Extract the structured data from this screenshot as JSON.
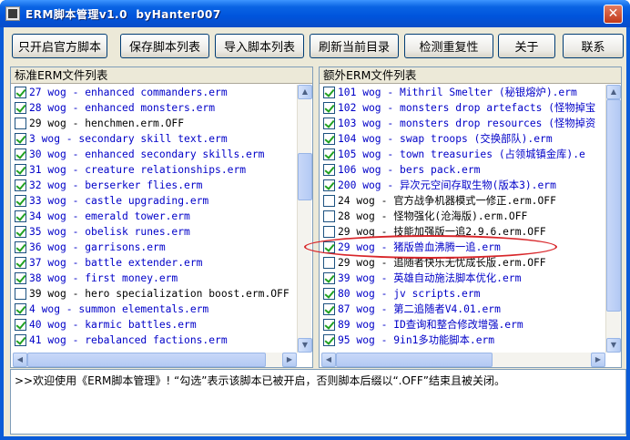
{
  "window": {
    "title": "ERM脚本管理v1.0  byHanter007",
    "close_label": "✕"
  },
  "toolbar": [
    {
      "label": "只开启官方脚本"
    },
    {
      "label": "保存脚本列表"
    },
    {
      "label": "导入脚本列表"
    },
    {
      "label": "刷新当前目录"
    },
    {
      "label": "检测重复性"
    },
    {
      "label": "关于"
    },
    {
      "label": "联系"
    }
  ],
  "left_panel": {
    "header": "标准ERM文件列表",
    "items": [
      {
        "text": "27 wog - enhanced commanders.erm",
        "checked": true
      },
      {
        "text": "28 wog - enhanced monsters.erm",
        "checked": true
      },
      {
        "text": "29 wog - henchmen.erm.OFF",
        "checked": false
      },
      {
        "text": "3 wog - secondary skill text.erm",
        "checked": true
      },
      {
        "text": "30 wog - enhanced secondary skills.erm",
        "checked": true
      },
      {
        "text": "31 wog - creature relationships.erm",
        "checked": true
      },
      {
        "text": "32 wog - berserker flies.erm",
        "checked": true
      },
      {
        "text": "33 wog - castle upgrading.erm",
        "checked": true
      },
      {
        "text": "34 wog - emerald tower.erm",
        "checked": true
      },
      {
        "text": "35 wog - obelisk runes.erm",
        "checked": true
      },
      {
        "text": "36 wog - garrisons.erm",
        "checked": true
      },
      {
        "text": "37 wog - battle extender.erm",
        "checked": true
      },
      {
        "text": "38 wog - first money.erm",
        "checked": true
      },
      {
        "text": "39 wog - hero specialization boost.erm.OFF",
        "checked": false
      },
      {
        "text": "4 wog - summon elementals.erm",
        "checked": true
      },
      {
        "text": "40 wog - karmic battles.erm",
        "checked": true
      },
      {
        "text": "41 wog - rebalanced factions.erm",
        "checked": true
      }
    ]
  },
  "right_panel": {
    "header": "额外ERM文件列表",
    "items": [
      {
        "text": "101 wog - Mithril Smelter (秘银熔炉).erm",
        "checked": true
      },
      {
        "text": "102 wog - monsters drop artefacts (怪物掉宝",
        "checked": true
      },
      {
        "text": "103 wog - monsters drop resources (怪物掉资",
        "checked": true
      },
      {
        "text": "104 wog - swap troops (交换部队).erm",
        "checked": true
      },
      {
        "text": "105 wog - town treasuries (占领城镇金库).e",
        "checked": true
      },
      {
        "text": "106 wog - bers pack.erm",
        "checked": true
      },
      {
        "text": "200 wog - 异次元空间存取生物(版本3).erm",
        "checked": true
      },
      {
        "text": "24 wog - 官方战争机器模式一修正.erm.OFF",
        "checked": false
      },
      {
        "text": "28 wog - 怪物强化(沧海版).erm.OFF",
        "checked": false
      },
      {
        "text": "29 wog - 技能加强版一追2.9.6.erm.OFF",
        "checked": false
      },
      {
        "text": "29 wog - 猪版兽血沸腾一追.erm",
        "checked": true
      },
      {
        "text": "29 wog - 追随者快乐无忧成长版.erm.OFF",
        "checked": false
      },
      {
        "text": "39 wog - 英雄自动施法脚本优化.erm",
        "checked": true
      },
      {
        "text": "80 wog - jv scripts.erm",
        "checked": true
      },
      {
        "text": "87 wog - 第二追随者V4.01.erm",
        "checked": true
      },
      {
        "text": "89 wog - ID查询和整合修改增强.erm",
        "checked": true
      },
      {
        "text": "95 wog - 9in1多功能脚本.erm",
        "checked": true
      }
    ]
  },
  "log": {
    "text": ">>欢迎使用《ERM脚本管理》! “勾选”表示该脚本已被开启，否则脚本后缀以“.OFF”结束且被关闭。"
  },
  "colors": {
    "enabled_text": "#0000c8",
    "disabled_text": "#000000",
    "check_mark": "#21a121",
    "highlight_ellipse": "#d8262a"
  }
}
